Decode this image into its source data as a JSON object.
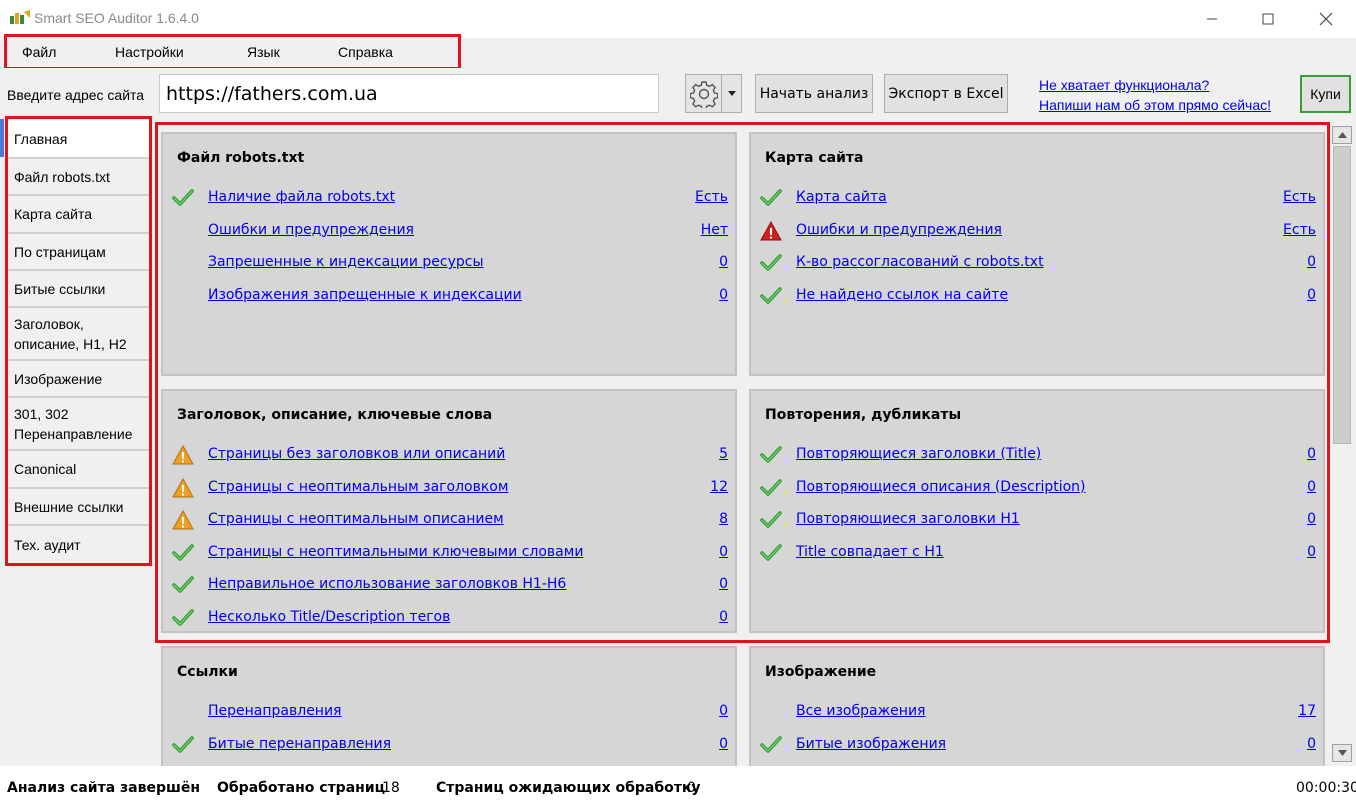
{
  "window": {
    "title": "Smart SEO Auditor 1.6.4.0"
  },
  "menu": {
    "items": [
      "Файл",
      "Настройки",
      "Язык",
      "Справка"
    ]
  },
  "toolbar": {
    "url_label": "Введите адрес сайта",
    "url_value": "https://fathers.com.ua",
    "start_label": "Начать анализ",
    "export_label": "Экспорт в Excel",
    "promo_line1": "Не хватает функционала?",
    "promo_line2": "Напиши нам об этом прямо сейчас!",
    "buy_label": "Купи"
  },
  "sidebar": {
    "items": [
      {
        "label": "Главная",
        "active": true
      },
      {
        "label": "Файл robots.txt"
      },
      {
        "label": "Карта сайта"
      },
      {
        "label": "По страницам"
      },
      {
        "label": "Битые ссылки"
      },
      {
        "label": "Заголовок, описание, H1, H2"
      },
      {
        "label": "Изображение"
      },
      {
        "label": "301, 302 Перенаправление"
      },
      {
        "label": "Canonical"
      },
      {
        "label": "Внешние ссылки"
      },
      {
        "label": "Тех. аудит"
      }
    ]
  },
  "panels": {
    "robots": {
      "title": "Файл robots.txt",
      "rows": [
        {
          "icon": "check",
          "label": "Наличие файла robots.txt",
          "value": "Есть"
        },
        {
          "icon": "none",
          "label": "Ошибки и предупреждения",
          "value": "Нет"
        },
        {
          "icon": "none",
          "label": "Запрешенные к индексации ресурсы",
          "value": "0"
        },
        {
          "icon": "none",
          "label": "Изображения запрещенные к индексации",
          "value": "0"
        }
      ]
    },
    "sitemap": {
      "title": "Карта сайта",
      "rows": [
        {
          "icon": "check",
          "label": "Карта сайта",
          "value": "Есть"
        },
        {
          "icon": "error",
          "label": "Ошибки и предупреждения",
          "value": "Есть"
        },
        {
          "icon": "check",
          "label": "К-во рассогласований с robots.txt",
          "value": "0"
        },
        {
          "icon": "check",
          "label": "Не найдено ссылок на сайте",
          "value": "0"
        }
      ]
    },
    "headers": {
      "title": "Заголовок, описание, ключевые слова",
      "rows": [
        {
          "icon": "warning",
          "label": "Страницы без заголовков или описаний",
          "value": "5"
        },
        {
          "icon": "warning",
          "label": "Страницы с неоптимальным заголовком",
          "value": "12"
        },
        {
          "icon": "warning",
          "label": "Страницы с неоптимальным описанием",
          "value": "8"
        },
        {
          "icon": "check",
          "label": "Страницы с неоптимальными ключевыми словами",
          "value": "0"
        },
        {
          "icon": "check",
          "label": "Неправильное использование заголовков H1-H6",
          "value": "0"
        },
        {
          "icon": "check",
          "label": "Несколько Title/Description тегов",
          "value": "0"
        }
      ]
    },
    "duplicates": {
      "title": "Повторения, дубликаты",
      "rows": [
        {
          "icon": "check",
          "label": "Повторяющиеся заголовки (Title)",
          "value": "0"
        },
        {
          "icon": "check",
          "label": "Повторяющиеся описания (Description)",
          "value": "0"
        },
        {
          "icon": "check",
          "label": "Повторяющиеся заголовки H1",
          "value": "0"
        },
        {
          "icon": "check",
          "label": "Title совпадает с H1",
          "value": "0"
        }
      ]
    },
    "links": {
      "title": "Ссылки",
      "rows": [
        {
          "icon": "none",
          "label": "Перенаправления",
          "value": "0"
        },
        {
          "icon": "check",
          "label": "Битые перенаправления",
          "value": "0"
        }
      ]
    },
    "images": {
      "title": "Изображение",
      "rows": [
        {
          "icon": "none",
          "label": "Все изображения",
          "value": "17"
        },
        {
          "icon": "check",
          "label": "Битые изображения",
          "value": "0"
        }
      ]
    }
  },
  "status": {
    "done_label": "Анализ сайта завершён",
    "processed_label": "Обработано страниц",
    "processed_value": "18",
    "pending_label": "Страниц ожидающих обработку",
    "pending_value": "0",
    "timer": "00:00:30"
  },
  "colors": {
    "highlight_frame": "#e0151b",
    "link": "#0000ee",
    "check": "#2e9e2e",
    "warning": "#f0a020",
    "error": "#d02020"
  }
}
